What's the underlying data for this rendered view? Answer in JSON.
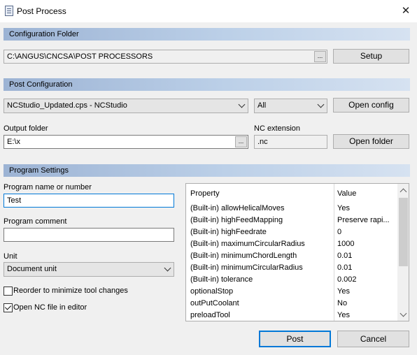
{
  "window": {
    "title": "Post Process",
    "close_glyph": "✕"
  },
  "config_folder": {
    "header": "Configuration Folder",
    "path": "C:\\ANGUS\\CNCSA\\POST PROCESSORS",
    "browse": "...",
    "setup_label": "Setup"
  },
  "post_config": {
    "header": "Post Configuration",
    "post_selected": "NCStudio_Updated.cps - NCStudio",
    "filter_selected": "All",
    "open_config_label": "Open config",
    "output_folder_label": "Output folder",
    "output_folder_value": "E:\\x",
    "browse": "...",
    "nc_extension_label": "NC extension",
    "nc_extension_value": ".nc",
    "open_folder_label": "Open folder"
  },
  "program_settings": {
    "header": "Program Settings",
    "program_name_label": "Program name or number",
    "program_name_value": "Test",
    "program_comment_label": "Program comment",
    "program_comment_value": "",
    "unit_label": "Unit",
    "unit_selected": "Document unit",
    "reorder_label": "Reorder to minimize tool changes",
    "reorder_checked": false,
    "open_nc_label": "Open NC file in editor",
    "open_nc_checked": true
  },
  "properties": {
    "col_property": "Property",
    "col_value": "Value",
    "rows": [
      {
        "name": "(Built-in) allowHelicalMoves",
        "value": "Yes"
      },
      {
        "name": "(Built-in) highFeedMapping",
        "value": "Preserve rapi..."
      },
      {
        "name": "(Built-in) highFeedrate",
        "value": "0"
      },
      {
        "name": "(Built-in) maximumCircularRadius",
        "value": "1000"
      },
      {
        "name": "(Built-in) minimumChordLength",
        "value": "0.01"
      },
      {
        "name": "(Built-in) minimumCircularRadius",
        "value": "0.01"
      },
      {
        "name": "(Built-in) tolerance",
        "value": "0.002"
      },
      {
        "name": "optionalStop",
        "value": "Yes"
      },
      {
        "name": "outPutCoolant",
        "value": "No"
      },
      {
        "name": "preloadTool",
        "value": "Yes"
      }
    ]
  },
  "footer": {
    "post_label": "Post",
    "cancel_label": "Cancel"
  }
}
